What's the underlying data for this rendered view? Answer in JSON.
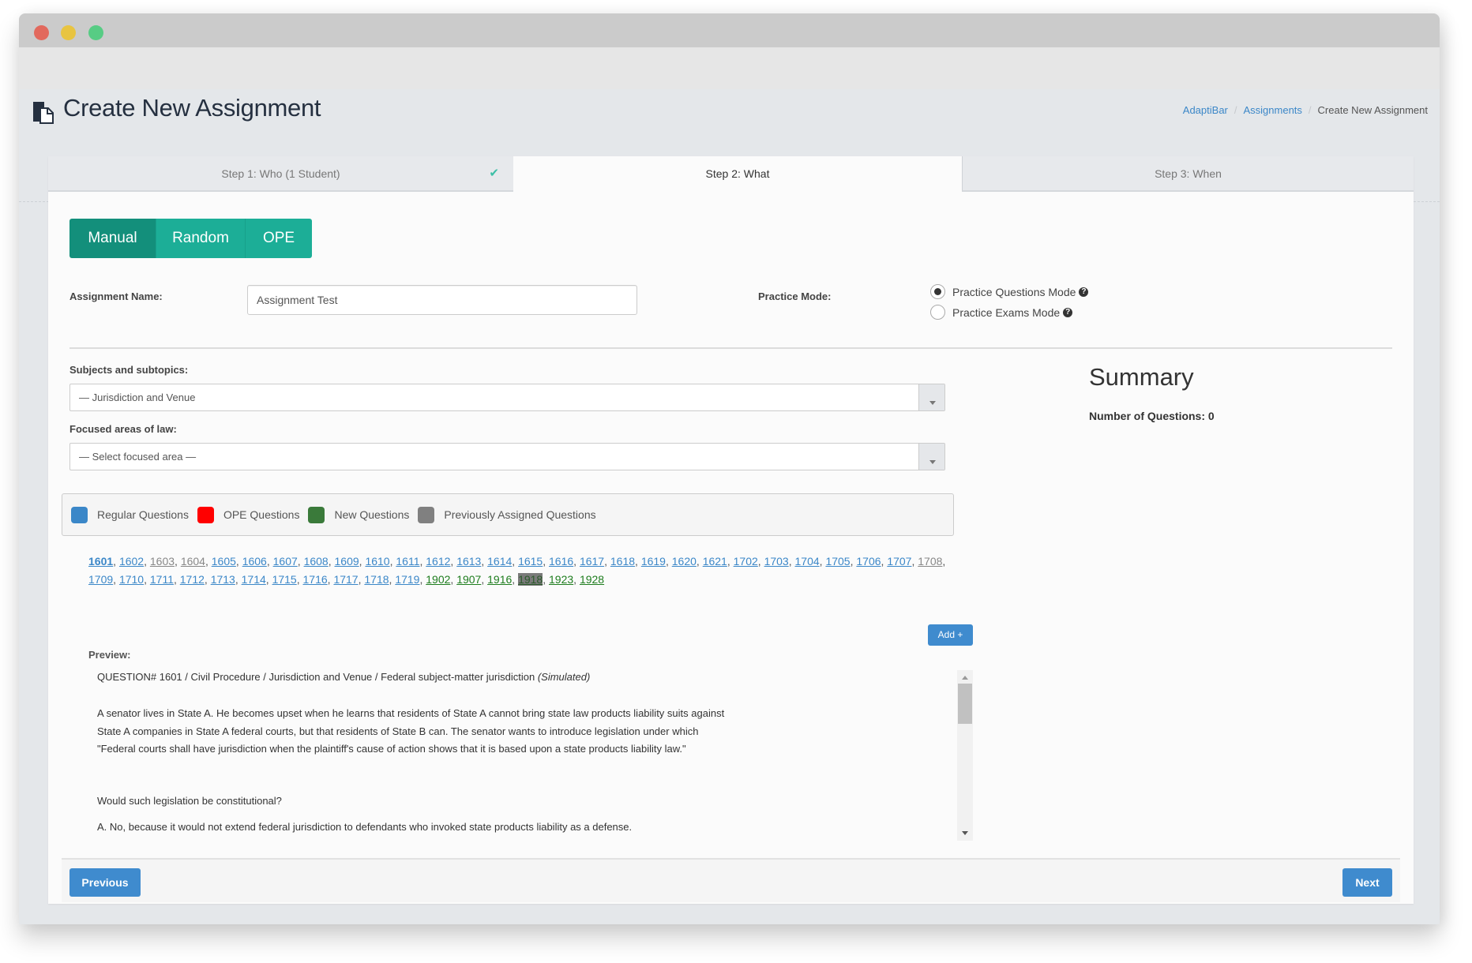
{
  "window": {
    "controls": [
      "close",
      "minimize",
      "maximize"
    ]
  },
  "header": {
    "title": "Create New Assignment",
    "icon": "assignment-icon",
    "breadcrumb": [
      {
        "label": "AdaptiBar",
        "link": true
      },
      {
        "label": "Assignments",
        "link": true
      },
      {
        "label": "Create New Assignment",
        "link": false
      }
    ]
  },
  "steps": [
    {
      "label": "Step 1: Who (1 Student)",
      "completed": true,
      "active": false
    },
    {
      "label": "Step 2: What",
      "completed": false,
      "active": true
    },
    {
      "label": "Step 3: When",
      "completed": false,
      "active": false
    }
  ],
  "modes": [
    {
      "label": "Manual",
      "active": true
    },
    {
      "label": "Random",
      "active": false
    },
    {
      "label": "OPE",
      "active": false
    }
  ],
  "form": {
    "assignment_name_label": "Assignment Name:",
    "assignment_name_value": "Assignment Test",
    "practice_mode_label": "Practice Mode:",
    "practice_modes": [
      {
        "label": "Practice Questions Mode",
        "checked": true
      },
      {
        "label": "Practice Exams Mode",
        "checked": false
      }
    ],
    "subjects_label": "Subjects and subtopics:",
    "subjects_value": "— Jurisdiction and Venue",
    "focused_label": "Focused areas of law:",
    "focused_value": "— Select focused area —"
  },
  "legend": [
    {
      "label": "Regular Questions",
      "color": "#3b87c8"
    },
    {
      "label": "OPE Questions",
      "color": "#ff0000"
    },
    {
      "label": "New Questions",
      "color": "#3a7a3a"
    },
    {
      "label": "Previously Assigned Questions",
      "color": "#808080"
    }
  ],
  "questions": [
    {
      "n": "1601",
      "type": "regular",
      "selected": true
    },
    {
      "n": "1602",
      "type": "regular"
    },
    {
      "n": "1603",
      "type": "prev"
    },
    {
      "n": "1604",
      "type": "prev"
    },
    {
      "n": "1605",
      "type": "regular"
    },
    {
      "n": "1606",
      "type": "regular"
    },
    {
      "n": "1607",
      "type": "regular"
    },
    {
      "n": "1608",
      "type": "regular"
    },
    {
      "n": "1609",
      "type": "regular"
    },
    {
      "n": "1610",
      "type": "regular"
    },
    {
      "n": "1611",
      "type": "regular"
    },
    {
      "n": "1612",
      "type": "regular"
    },
    {
      "n": "1613",
      "type": "regular"
    },
    {
      "n": "1614",
      "type": "regular"
    },
    {
      "n": "1615",
      "type": "regular"
    },
    {
      "n": "1616",
      "type": "regular"
    },
    {
      "n": "1617",
      "type": "regular"
    },
    {
      "n": "1618",
      "type": "regular"
    },
    {
      "n": "1619",
      "type": "regular"
    },
    {
      "n": "1620",
      "type": "regular"
    },
    {
      "n": "1621",
      "type": "regular"
    },
    {
      "n": "1702",
      "type": "regular"
    },
    {
      "n": "1703",
      "type": "regular"
    },
    {
      "n": "1704",
      "type": "regular"
    },
    {
      "n": "1705",
      "type": "regular"
    },
    {
      "n": "1706",
      "type": "regular"
    },
    {
      "n": "1707",
      "type": "regular"
    },
    {
      "n": "1708",
      "type": "prev"
    },
    {
      "n": "1709",
      "type": "regular"
    },
    {
      "n": "1710",
      "type": "regular"
    },
    {
      "n": "1711",
      "type": "regular"
    },
    {
      "n": "1712",
      "type": "regular"
    },
    {
      "n": "1713",
      "type": "regular"
    },
    {
      "n": "1714",
      "type": "regular"
    },
    {
      "n": "1715",
      "type": "regular"
    },
    {
      "n": "1716",
      "type": "regular"
    },
    {
      "n": "1717",
      "type": "regular"
    },
    {
      "n": "1718",
      "type": "regular"
    },
    {
      "n": "1719",
      "type": "regular"
    },
    {
      "n": "1902",
      "type": "new"
    },
    {
      "n": "1907",
      "type": "new"
    },
    {
      "n": "1916",
      "type": "new"
    },
    {
      "n": "1918",
      "type": "new",
      "highlighted": true
    },
    {
      "n": "1923",
      "type": "new"
    },
    {
      "n": "1928",
      "type": "new"
    }
  ],
  "add_button": "Add +",
  "preview": {
    "label": "Preview:",
    "header": "QUESTION# 1601 / Civil Procedure / Jurisdiction and Venue / Federal subject-matter jurisdiction",
    "header_tag": "(Simulated)",
    "body": "A senator lives in State A. He becomes upset when he learns that residents of State A cannot bring state law products liability suits against State A companies in State A federal courts, but that residents of State B can. The senator wants to introduce legislation under which \"Federal courts shall have jurisdiction when the plaintiff's cause of action shows that it is based upon a state products liability law.\"",
    "question": "Would such legislation be constitutional?",
    "answer_a": "A. No, because it would not extend federal jurisdiction to defendants who invoked state products liability as a defense."
  },
  "summary": {
    "title": "Summary",
    "count_label": "Number of Questions: 0"
  },
  "footer": {
    "previous": "Previous",
    "next": "Next"
  }
}
